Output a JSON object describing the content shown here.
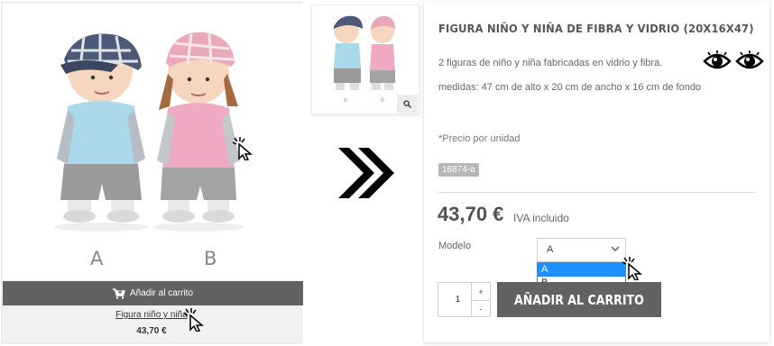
{
  "listing": {
    "product_name": "Figura niño y niña",
    "price": "43,70 €",
    "add_to_cart_label": "Añadir al carrito",
    "figure_labels": [
      "A",
      "B"
    ]
  },
  "gallery": {
    "thumbnail_labels": [
      "A",
      "B"
    ],
    "zoom_icon": "magnifier-icon"
  },
  "transition_icon": "double-chevron-right-icon",
  "product": {
    "title": "FIGURA NIÑO Y NIÑA DE FIBRA Y VIDRIO (20X16X47)",
    "description": "2 figuras de niño y niña fabricadas en vidrio y fibra.",
    "measures": "medidas: 47 cm de alto x 20 cm de ancho x 16 cm de fondo",
    "unit_note": "*Precio por unidad",
    "reference": "16874-a",
    "price": "43,70 €",
    "tax_label": "IVA incluido",
    "icons": [
      "eye-icon",
      "eye-icon"
    ],
    "model": {
      "label": "Modelo",
      "selected": "A",
      "options": [
        "A",
        "B"
      ],
      "highlighted": "A"
    },
    "quantity": "1",
    "stepper": {
      "up": "+",
      "down": "-"
    },
    "add_to_cart_label": "AÑADIR AL CARRITO"
  },
  "colors": {
    "button_gray": "#626262",
    "highlight_blue": "#1e90ff",
    "boy_shirt": "#a9d9ea",
    "girl_shirt": "#f0a9c2"
  }
}
